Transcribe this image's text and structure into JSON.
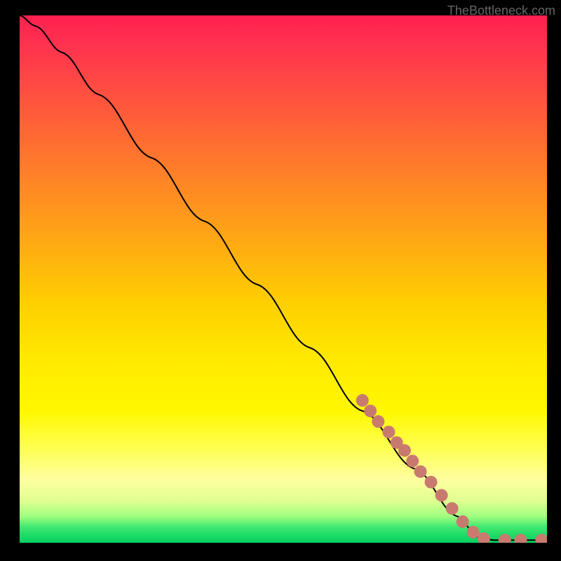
{
  "watermark": "TheBottleneck.com",
  "chart_data": {
    "type": "line",
    "title": "",
    "xlabel": "",
    "ylabel": "",
    "xlim": [
      0,
      100
    ],
    "ylim": [
      0,
      100
    ],
    "curve_points": [
      {
        "x": 0,
        "y": 100
      },
      {
        "x": 3,
        "y": 98
      },
      {
        "x": 8,
        "y": 93
      },
      {
        "x": 15,
        "y": 85
      },
      {
        "x": 25,
        "y": 73
      },
      {
        "x": 35,
        "y": 61
      },
      {
        "x": 45,
        "y": 49
      },
      {
        "x": 55,
        "y": 37
      },
      {
        "x": 65,
        "y": 25
      },
      {
        "x": 75,
        "y": 14
      },
      {
        "x": 83,
        "y": 5
      },
      {
        "x": 87,
        "y": 1
      },
      {
        "x": 90,
        "y": 0.5
      },
      {
        "x": 95,
        "y": 0.5
      },
      {
        "x": 100,
        "y": 0.5
      }
    ],
    "dots": [
      {
        "x": 65,
        "y": 27
      },
      {
        "x": 66.5,
        "y": 25
      },
      {
        "x": 68,
        "y": 23
      },
      {
        "x": 70,
        "y": 21
      },
      {
        "x": 71.5,
        "y": 19
      },
      {
        "x": 73,
        "y": 17.5
      },
      {
        "x": 74.5,
        "y": 15.5
      },
      {
        "x": 76,
        "y": 13.5
      },
      {
        "x": 78,
        "y": 11.5
      },
      {
        "x": 80,
        "y": 9
      },
      {
        "x": 82,
        "y": 6.5
      },
      {
        "x": 84,
        "y": 4
      },
      {
        "x": 86,
        "y": 2
      },
      {
        "x": 88,
        "y": 0.8
      },
      {
        "x": 92,
        "y": 0.5
      },
      {
        "x": 95,
        "y": 0.5
      },
      {
        "x": 99,
        "y": 0.5
      }
    ]
  }
}
